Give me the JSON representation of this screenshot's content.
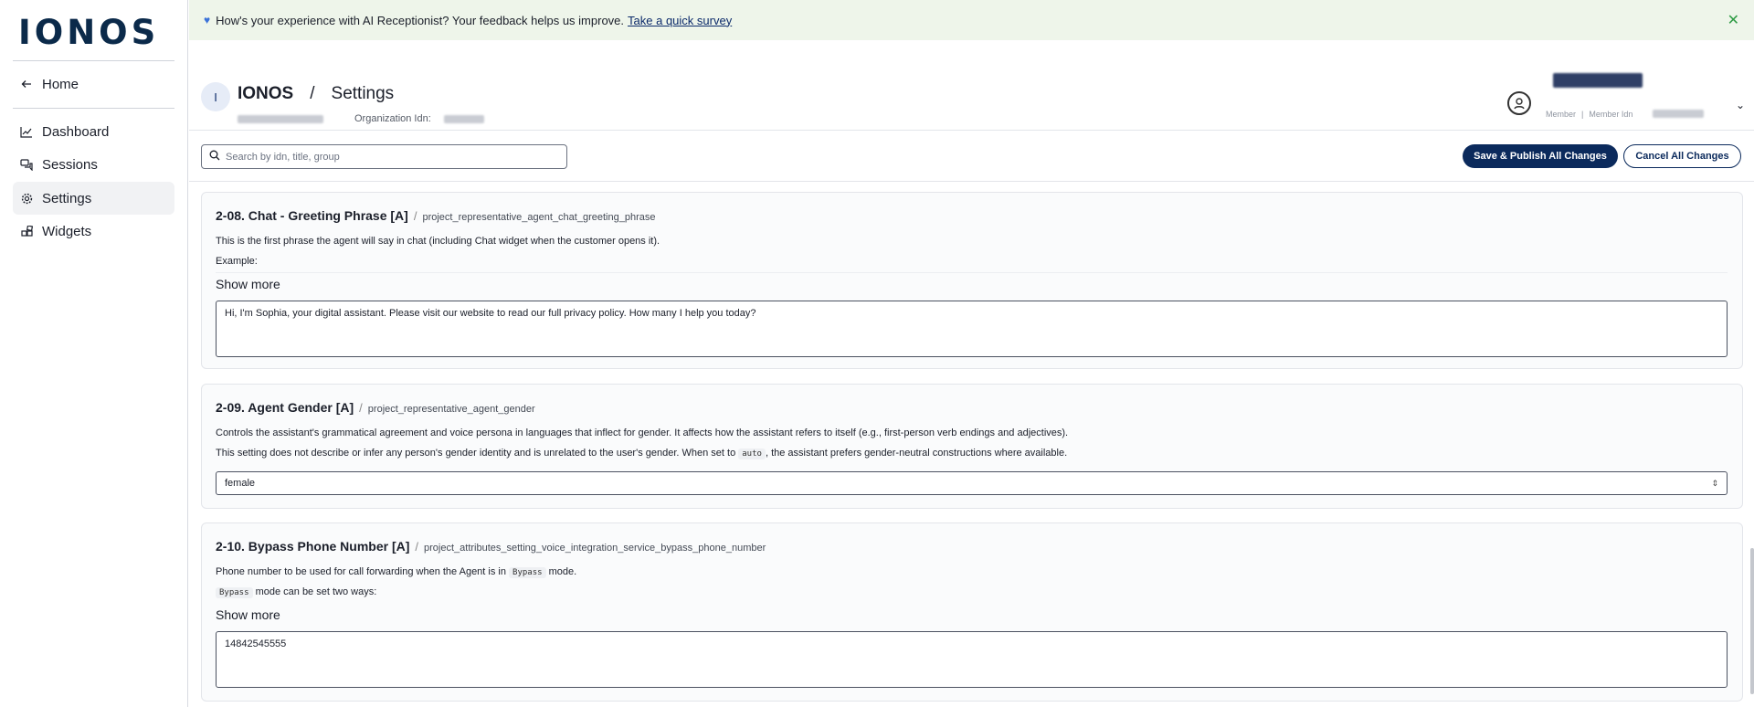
{
  "sidebar": {
    "logo": "IONOS",
    "items": [
      {
        "label": "Home",
        "icon": "arrow-left-icon"
      },
      {
        "label": "Dashboard",
        "icon": "chart-icon"
      },
      {
        "label": "Sessions",
        "icon": "chat-icon"
      },
      {
        "label": "Settings",
        "icon": "gear-icon",
        "active": true
      },
      {
        "label": "Widgets",
        "icon": "widgets-icon"
      }
    ]
  },
  "banner": {
    "text": "How's your experience with AI Receptionist? Your feedback helps us improve.",
    "link": "Take a quick survey",
    "icon": "heart-icon"
  },
  "header": {
    "avatar_letter": "I",
    "org": "IONOS",
    "separator": "/",
    "page": "Settings",
    "org_id_label": "Organization Idn:",
    "member_label_1": "Member",
    "member_label_2": "Member Idn"
  },
  "toolbar": {
    "search_placeholder": "Search by idn, title, group",
    "save_label": "Save & Publish All Changes",
    "cancel_label": "Cancel All Changes"
  },
  "cards": [
    {
      "title": "2-08. Chat - Greeting Phrase [A]",
      "key": "project_representative_agent_chat_greeting_phrase",
      "desc": "This is the first phrase the agent will say in chat (including Chat widget when the customer opens it).",
      "example": "Example:",
      "show_more": "Show more",
      "value": "Hi, I'm Sophia, your digital assistant. Please visit our website to read our full privacy policy. How many I help you today?"
    },
    {
      "title": "2-09. Agent Gender [A]",
      "key": "project_representative_agent_gender",
      "desc1": "Controls the assistant's grammatical agreement and voice persona in languages that inflect for gender. It affects how the assistant refers to itself (e.g., first-person verb endings and adjectives).",
      "desc2_a": "This setting does not describe or infer any person's gender identity and is unrelated to the user's gender. When set to",
      "desc2_code": "auto",
      "desc2_b": ", the assistant prefers gender-neutral constructions where available.",
      "value": "female"
    },
    {
      "title": "2-10. Bypass Phone Number [A]",
      "key": "project_attributes_setting_voice_integration_service_bypass_phone_number",
      "desc1_a": "Phone number to be used for call forwarding when the Agent is in",
      "desc1_code": "Bypass",
      "desc1_b": "mode.",
      "desc2_code": "Bypass",
      "desc2_b": "mode can be set two ways:",
      "show_more": "Show more",
      "value": "14842545555"
    }
  ]
}
